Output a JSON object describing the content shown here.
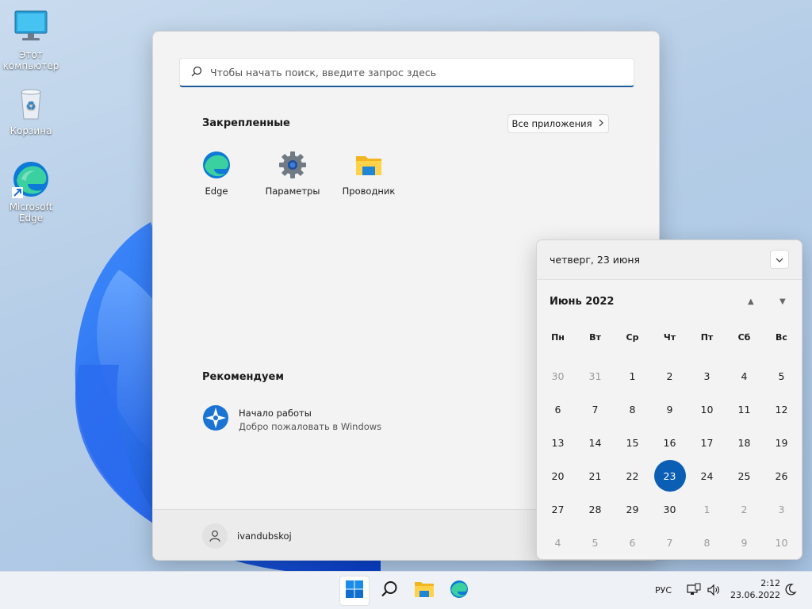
{
  "desktop": {
    "icons": [
      {
        "name": "this-pc",
        "label_line1": "Этот",
        "label_line2": "компьютер",
        "icon": "monitor-icon"
      },
      {
        "name": "recycle-bin",
        "label_line1": "Корзина",
        "label_line2": "",
        "icon": "recycle-bin-icon"
      },
      {
        "name": "microsoft-edge",
        "label_line1": "Microsoft",
        "label_line2": "Edge",
        "icon": "edge-icon"
      }
    ]
  },
  "start_menu": {
    "search_placeholder": "Чтобы начать поиск, введите запрос здесь",
    "pinned_title": "Закрепленные",
    "all_apps_label": "Все приложения",
    "pinned_apps": [
      {
        "label": "Edge",
        "icon": "edge-icon"
      },
      {
        "label": "Параметры",
        "icon": "gear-icon"
      },
      {
        "label": "Проводник",
        "icon": "folder-icon"
      }
    ],
    "recommended_title": "Рекомендуем",
    "recommended": [
      {
        "title": "Начало работы",
        "subtitle": "Добро пожаловать в Windows",
        "icon": "get-started-icon"
      }
    ],
    "user_name": "ivandubskoj"
  },
  "calendar": {
    "header_date": "четверг, 23 июня",
    "month_label": "Июнь 2022",
    "weekdays": [
      "Пн",
      "Вт",
      "Ср",
      "Чт",
      "Пт",
      "Сб",
      "Вс"
    ],
    "today": 23,
    "accent": "#0a5fb4",
    "weeks": [
      [
        {
          "d": "30",
          "m": true
        },
        {
          "d": "31",
          "m": true
        },
        {
          "d": "1"
        },
        {
          "d": "2"
        },
        {
          "d": "3"
        },
        {
          "d": "4"
        },
        {
          "d": "5"
        }
      ],
      [
        {
          "d": "6"
        },
        {
          "d": "7"
        },
        {
          "d": "8"
        },
        {
          "d": "9"
        },
        {
          "d": "10"
        },
        {
          "d": "11"
        },
        {
          "d": "12"
        }
      ],
      [
        {
          "d": "13"
        },
        {
          "d": "14"
        },
        {
          "d": "15"
        },
        {
          "d": "16"
        },
        {
          "d": "17"
        },
        {
          "d": "18"
        },
        {
          "d": "19"
        }
      ],
      [
        {
          "d": "20"
        },
        {
          "d": "21"
        },
        {
          "d": "22"
        },
        {
          "d": "23",
          "t": true
        },
        {
          "d": "24"
        },
        {
          "d": "25"
        },
        {
          "d": "26"
        }
      ],
      [
        {
          "d": "27"
        },
        {
          "d": "28"
        },
        {
          "d": "29"
        },
        {
          "d": "30"
        },
        {
          "d": "1",
          "m": true
        },
        {
          "d": "2",
          "m": true
        },
        {
          "d": "3",
          "m": true
        }
      ],
      [
        {
          "d": "4",
          "m": true
        },
        {
          "d": "5",
          "m": true
        },
        {
          "d": "6",
          "m": true
        },
        {
          "d": "7",
          "m": true
        },
        {
          "d": "8",
          "m": true
        },
        {
          "d": "9",
          "m": true
        },
        {
          "d": "10",
          "m": true
        }
      ]
    ]
  },
  "taskbar": {
    "buttons": [
      "start-icon",
      "search-icon",
      "file-explorer-icon",
      "edge-icon"
    ],
    "language": "РУС",
    "time": "2:12",
    "date": "23.06.2022"
  }
}
